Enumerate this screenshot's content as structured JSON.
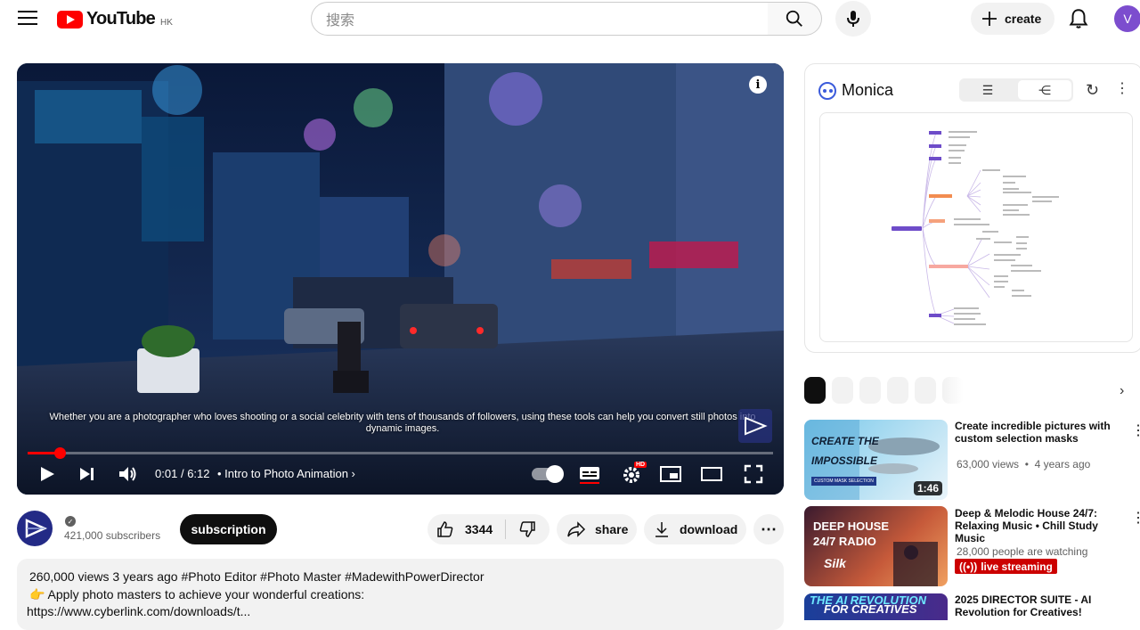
{
  "header": {
    "logo_text": "YouTube",
    "country_code": "HK",
    "search_placeholder": "搜索",
    "create_label": "create",
    "avatar_letter": "V"
  },
  "player": {
    "caption": "Whether you are a photographer who loves shooting or a social celebrity with tens of thousands of followers, using these tools can help you convert still photos into dynamic images.",
    "current_time": "0:01",
    "separator": "/",
    "duration": "6:12",
    "chapter": "Intro to Photo Animation",
    "progress_fraction": 0.003,
    "hd_badge": "HD"
  },
  "video_meta": {
    "subscribers": "421,000 subscribers",
    "subscribe_label": "subscription",
    "likes": "3344",
    "share_label": "share",
    "download_label": "download"
  },
  "description": {
    "line1": "260,000 views 3 years ago #Photo Editor #Photo Master #MadewithPowerDirector",
    "line2": "👉 Apply photo masters to achieve your wonderful creations:",
    "line3": "https://www.cyberlink.com/downloads/t..."
  },
  "monica": {
    "name": "Monica"
  },
  "recommendations": [
    {
      "title": "Create incredible pictures with custom selection masks",
      "views": "63,000 views",
      "age": "4 years ago",
      "duration": "1:46",
      "thumb_text_1": "CREATE THE",
      "thumb_text_2": "IMPOSSIBLE",
      "thumb_tag": "CUSTOM MASK SELECTION"
    },
    {
      "title": "Deep & Melodic House 24/7: Relaxing Music • Chill Study Music",
      "viewers": "28,000 people are watching",
      "live_label": "live streaming",
      "thumb_text_1": "DEEP HOUSE",
      "thumb_text_2": "24/7 RADIO",
      "thumb_brand": "Silk"
    },
    {
      "title": "2025 DIRECTOR SUITE - AI Revolution for Creatives!",
      "thumb_text_1": "THE AI REVOLUTION",
      "thumb_text_2": "FOR CREATIVES"
    }
  ],
  "colors": {
    "brand_red": "#ff0000",
    "progress": "#ff0000",
    "live": "#cc0000"
  }
}
